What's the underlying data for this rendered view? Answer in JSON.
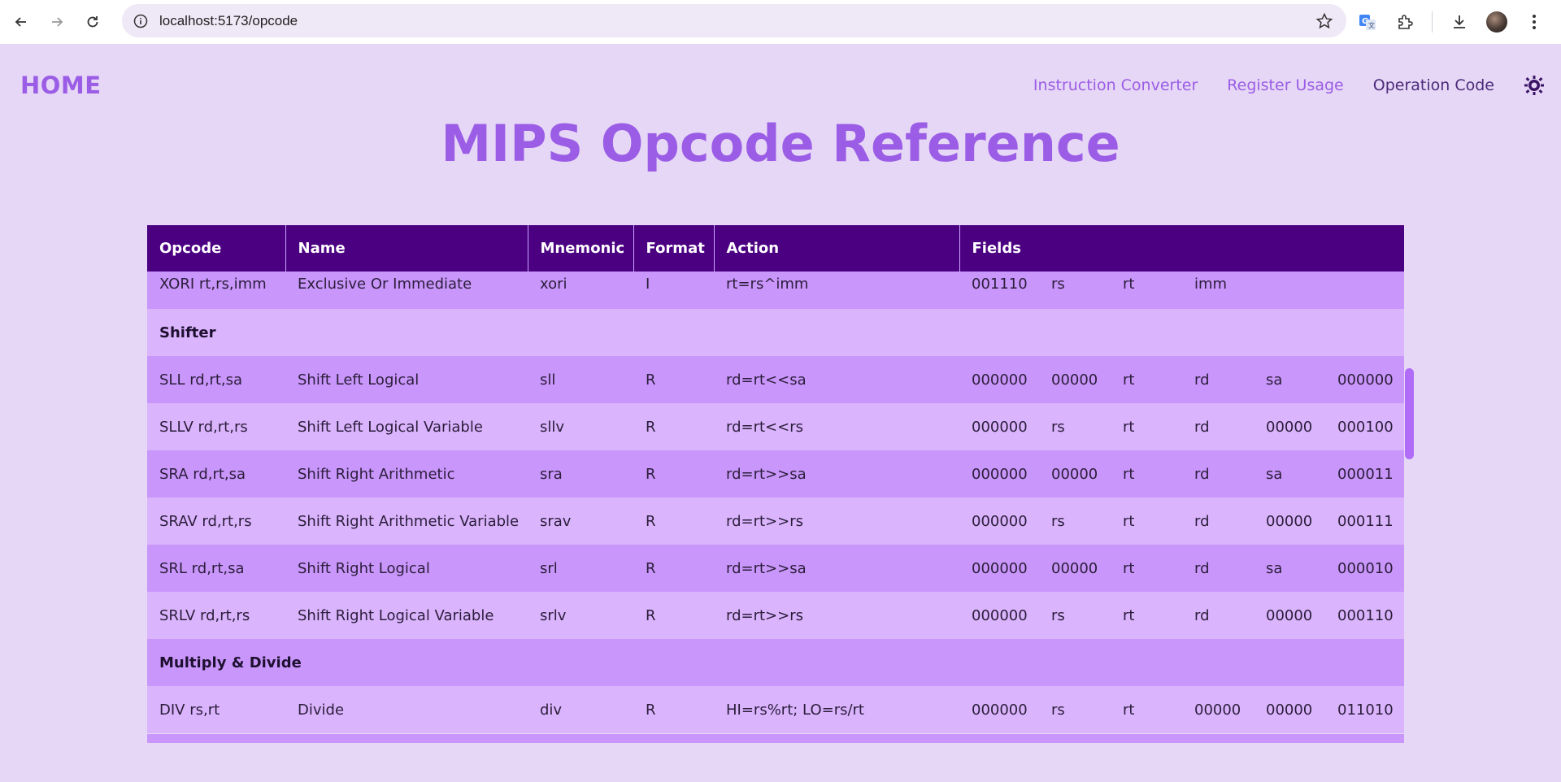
{
  "browser": {
    "url": "localhost:5173/opcode"
  },
  "nav": {
    "home": "HOME",
    "links": [
      "Instruction Converter",
      "Register Usage",
      "Operation Code"
    ],
    "active_index": 2
  },
  "page": {
    "title": "MIPS Opcode Reference"
  },
  "table": {
    "headers": [
      "Opcode",
      "Name",
      "Mnemonic",
      "Format",
      "Action",
      "Fields"
    ],
    "rows": [
      {
        "opcode": "XORI rt,rs,imm",
        "name": "Exclusive Or Immediate",
        "mnemonic": "xori",
        "format": "I",
        "action": "rt=rs^imm",
        "fields": [
          "001110",
          "rs",
          "rt",
          "imm",
          "",
          ""
        ]
      },
      {
        "group": "Shifter"
      },
      {
        "opcode": "SLL rd,rt,sa",
        "name": "Shift Left Logical",
        "mnemonic": "sll",
        "format": "R",
        "action": "rd=rt<<sa",
        "fields": [
          "000000",
          "00000",
          "rt",
          "rd",
          "sa",
          "000000"
        ]
      },
      {
        "opcode": "SLLV rd,rt,rs",
        "name": "Shift Left Logical Variable",
        "mnemonic": "sllv",
        "format": "R",
        "action": "rd=rt<<rs",
        "fields": [
          "000000",
          "rs",
          "rt",
          "rd",
          "00000",
          "000100"
        ]
      },
      {
        "opcode": "SRA rd,rt,sa",
        "name": "Shift Right Arithmetic",
        "mnemonic": "sra",
        "format": "R",
        "action": "rd=rt>>sa",
        "fields": [
          "000000",
          "00000",
          "rt",
          "rd",
          "sa",
          "000011"
        ]
      },
      {
        "opcode": "SRAV rd,rt,rs",
        "name": "Shift Right Arithmetic Variable",
        "mnemonic": "srav",
        "format": "R",
        "action": "rd=rt>>rs",
        "fields": [
          "000000",
          "rs",
          "rt",
          "rd",
          "00000",
          "000111"
        ]
      },
      {
        "opcode": "SRL rd,rt,sa",
        "name": "Shift Right Logical",
        "mnemonic": "srl",
        "format": "R",
        "action": "rd=rt>>sa",
        "fields": [
          "000000",
          "00000",
          "rt",
          "rd",
          "sa",
          "000010"
        ]
      },
      {
        "opcode": "SRLV rd,rt,rs",
        "name": "Shift Right Logical Variable",
        "mnemonic": "srlv",
        "format": "R",
        "action": "rd=rt>>rs",
        "fields": [
          "000000",
          "rs",
          "rt",
          "rd",
          "00000",
          "000110"
        ]
      },
      {
        "group": "Multiply & Divide"
      },
      {
        "opcode": "DIV rs,rt",
        "name": "Divide",
        "mnemonic": "div",
        "format": "R",
        "action": "HI=rs%rt; LO=rs/rt",
        "fields": [
          "000000",
          "rs",
          "rt",
          "00000",
          "00000",
          "011010"
        ]
      }
    ]
  },
  "icons": {
    "back": "arrow-left-icon",
    "forward": "arrow-right-icon",
    "reload": "reload-icon",
    "site_info": "info-icon",
    "bookmark": "star-icon",
    "translate": "translate-icon",
    "extensions": "puzzle-icon",
    "downloads": "download-icon",
    "menu": "kebab-menu-icon",
    "theme": "sun-icon"
  },
  "colors": {
    "accent": "#9b5de5",
    "header_bg": "#4b0082",
    "row_dark": "#c996fb",
    "row_light": "#dab4fd",
    "page_bg": "#e6d7f6"
  }
}
